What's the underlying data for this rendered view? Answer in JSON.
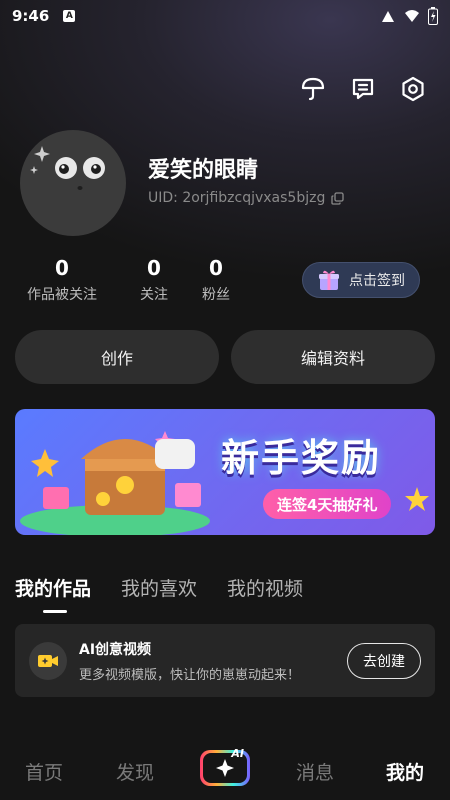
{
  "status_bar": {
    "time": "9:46",
    "badge": "A"
  },
  "profile": {
    "username": "爱笑的眼睛",
    "uid": "UID: 2orjfibzcqjvxas5bjzg"
  },
  "stats": [
    {
      "value": "0",
      "label": "作品被关注"
    },
    {
      "value": "0",
      "label": "关注"
    },
    {
      "value": "0",
      "label": "粉丝"
    }
  ],
  "signin": {
    "label": "点击签到"
  },
  "actions": {
    "create": "创作",
    "edit": "编辑资料"
  },
  "banner": {
    "title": "新手奖励",
    "subtitle": "连签4天抽好礼"
  },
  "tabs": [
    "我的作品",
    "我的喜欢",
    "我的视频"
  ],
  "ai_card": {
    "title": "AI创意视频",
    "desc": "更多视频模版，快让你的崽崽动起来！",
    "button": "去创建"
  },
  "bottom_nav": {
    "home": "首页",
    "discover": "发现",
    "ai_badge": "AI",
    "messages": "消息",
    "mine": "我的"
  },
  "icons": {
    "top_right": [
      "umbrella-icon",
      "message-square-icon",
      "settings-hexagon-icon"
    ],
    "copy": "copy-icon"
  },
  "colors": {
    "background": "#151515",
    "card": "#262626",
    "button": "#2e2e2e",
    "signin_bg": "#2f3a55",
    "banner_accent": "#e043c9"
  }
}
